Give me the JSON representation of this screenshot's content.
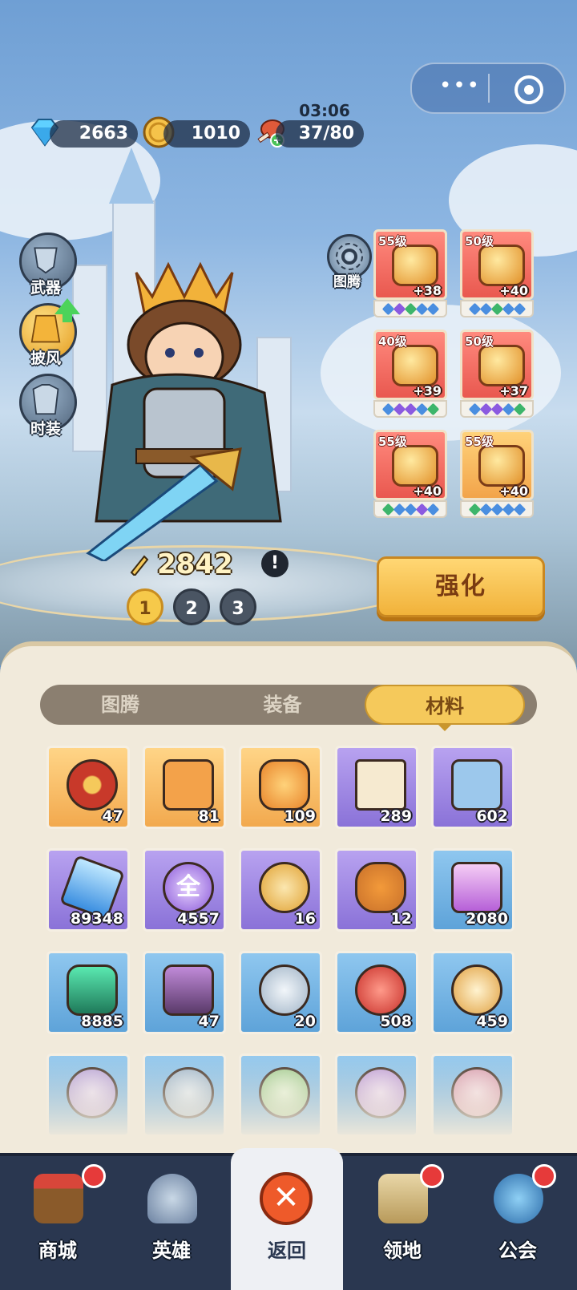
{
  "currencies": {
    "diamonds": "2663",
    "gold": "1010",
    "stamina": "37/80",
    "stamina_timer": "03:06"
  },
  "side_menu": [
    {
      "label": "武器",
      "icon": "weapon-icon"
    },
    {
      "label": "披风",
      "icon": "cape-icon"
    },
    {
      "label": "时装",
      "icon": "costume-icon"
    }
  ],
  "totem": {
    "label": "图腾",
    "icon": "totem-icon"
  },
  "equipment": [
    {
      "level": "55级",
      "bonus": "+38",
      "icon": "armor-icon"
    },
    {
      "level": "50级",
      "bonus": "+40",
      "icon": "ring-icon"
    },
    {
      "level": "40级",
      "bonus": "+39",
      "icon": "crown-icon"
    },
    {
      "level": "50级",
      "bonus": "+37",
      "icon": "horn-icon"
    },
    {
      "level": "55级",
      "bonus": "+40",
      "icon": "boots-icon"
    },
    {
      "level": "55级",
      "bonus": "+40",
      "icon": "gloves-icon"
    }
  ],
  "power": "2842",
  "info_label": "!",
  "pages": [
    "1",
    "2",
    "3"
  ],
  "active_page": "1",
  "enhance_label": "强化",
  "tabs": [
    {
      "label": "图腾",
      "active": false
    },
    {
      "label": "装备",
      "active": false
    },
    {
      "label": "材料",
      "active": true
    }
  ],
  "materials": [
    {
      "qty": "47",
      "rarity": "gold",
      "icon": "chip-icon"
    },
    {
      "qty": "81",
      "rarity": "gold",
      "icon": "gold-hammer-icon"
    },
    {
      "qty": "109",
      "rarity": "gold",
      "icon": "orange-stone-icon"
    },
    {
      "qty": "289",
      "rarity": "purple",
      "icon": "integral-scroll-icon"
    },
    {
      "qty": "602",
      "rarity": "purple",
      "icon": "blue-hammer-icon"
    },
    {
      "qty": "89348",
      "rarity": "purple",
      "icon": "blue-crystal-icon"
    },
    {
      "qty": "4557",
      "rarity": "purple",
      "icon": "all-orb-icon",
      "glyph": "全"
    },
    {
      "qty": "16",
      "rarity": "purple",
      "icon": "gold-compass-icon"
    },
    {
      "qty": "12",
      "rarity": "purple",
      "icon": "carrot-sack-icon"
    },
    {
      "qty": "2080",
      "rarity": "blue",
      "icon": "purple-crystal-icon"
    },
    {
      "qty": "8885",
      "rarity": "blue",
      "icon": "green-ore-icon"
    },
    {
      "qty": "47",
      "rarity": "blue",
      "icon": "log-icon"
    },
    {
      "qty": "20",
      "rarity": "blue",
      "icon": "silver-compass-icon"
    },
    {
      "qty": "508",
      "rarity": "blue",
      "icon": "sword-orb-icon"
    },
    {
      "qty": "459",
      "rarity": "blue",
      "icon": "wing-orb-icon"
    }
  ],
  "nav": [
    {
      "label": "商城",
      "icon": "shop-icon",
      "badge": true
    },
    {
      "label": "英雄",
      "icon": "helmet-icon",
      "badge": false
    },
    {
      "label": "返回",
      "icon": "close-icon",
      "badge": false,
      "active": true
    },
    {
      "label": "领地",
      "icon": "castle-icon",
      "badge": true
    },
    {
      "label": "公会",
      "icon": "planet-icon",
      "badge": true
    }
  ],
  "colors": {
    "accent_gold": "#f5c95b",
    "badge_red": "#e63a3a",
    "panel_bg": "#f1eadb",
    "nav_bg": "#2a3750"
  }
}
